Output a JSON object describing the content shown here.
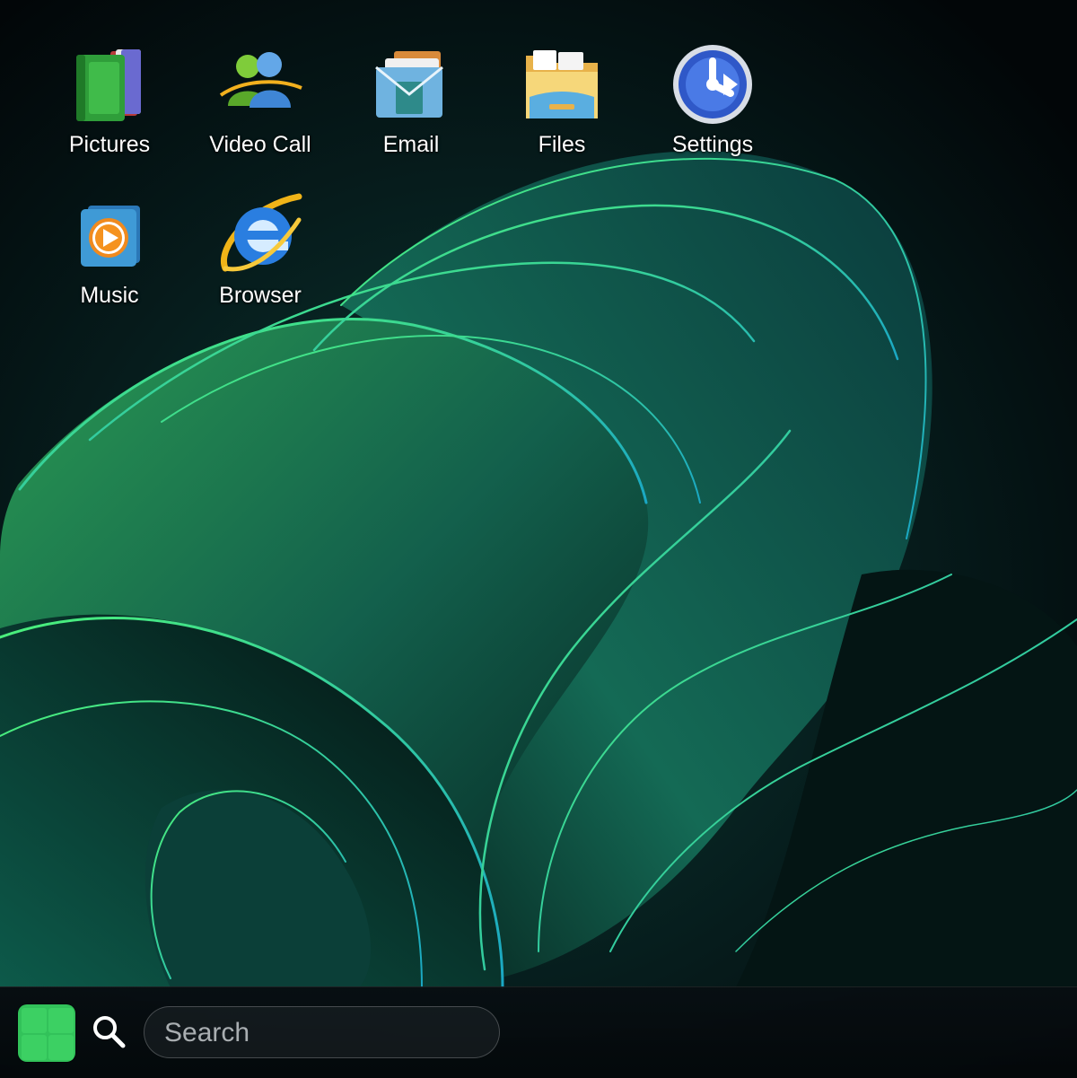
{
  "desktop": {
    "icons": [
      {
        "label": "Pictures",
        "icon": "green-books-icon"
      },
      {
        "label": "Video Call",
        "icon": "people-messenger-icon"
      },
      {
        "label": "Email",
        "icon": "mail-envelope-icon"
      },
      {
        "label": "Files",
        "icon": "folder-icon"
      },
      {
        "label": "Settings",
        "icon": "settings-arrow-icon"
      },
      {
        "label": "Music",
        "icon": "media-player-icon"
      },
      {
        "label": "Browser",
        "icon": "internet-explorer-icon"
      }
    ]
  },
  "taskbar": {
    "start_icon": "windows-start-icon",
    "search_icon": "magnifier-icon",
    "search": {
      "placeholder": "Search",
      "value": ""
    }
  },
  "colors": {
    "accent_green": "#32c25a",
    "wallpaper_base": "#030a0d",
    "wallpaper_ribbon": "#1f8a4a",
    "wallpaper_edge_glow": "#3cf07a",
    "text": "#ffffff"
  }
}
